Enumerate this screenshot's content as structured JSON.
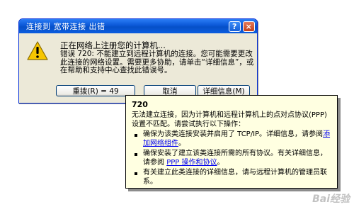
{
  "dialog": {
    "title": "连接到 宽带连接 出错",
    "help_button": "?",
    "close_button": "×",
    "status_text": "正在网络上注册您的计算机...",
    "error_text": "错误 720: 不能建立到远程计算机的连接。您可能需要更改此连接的网络设置。需要更多协助，请单击“详细信息”，或在帮助和支持中心查找此错误号。",
    "buttons": {
      "redial": "重拨(R) = 49",
      "cancel": "取消",
      "details": "详细信息(M)"
    }
  },
  "popup": {
    "code": "720",
    "description": "无法建立连接，因为计算机和远程计算机上的点对点协议(PPP)设置不匹配。请尝试执行以下操作：",
    "bullets": [
      {
        "pre": "确保为该类连接安装并启用了 TCP/IP。详细信息，请参阅",
        "link": "添加网络组件",
        "post": "。"
      },
      {
        "pre": "确保安装了建立该类连接所需的所有协议。有关详细信息，请参阅 ",
        "link": "PPP 操作和协议",
        "post": "。"
      },
      {
        "pre": "有关建立此类连接的详细信息，请与远程计算机的管理员联系。",
        "link": "",
        "post": ""
      }
    ]
  },
  "watermark": "Bai经验",
  "colors": {
    "titlebar": "#0a57d6",
    "dialog_bg": "#ece9d8",
    "popup_bg": "#ffffe1",
    "link": "#0000ee",
    "warning": "#f7c600"
  },
  "icons": {
    "warning": "warning-icon"
  }
}
